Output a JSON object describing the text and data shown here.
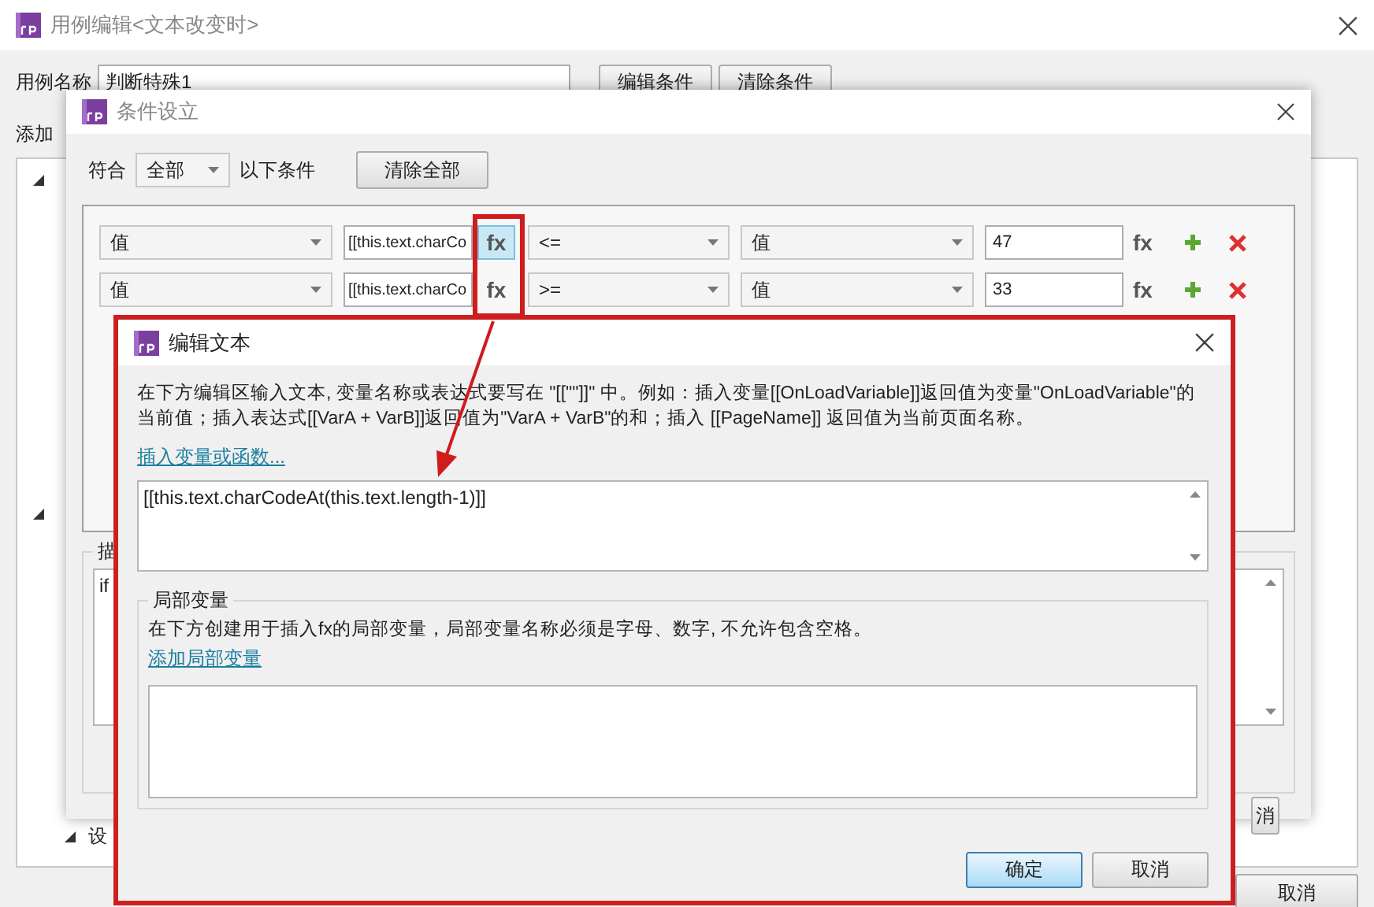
{
  "case_window": {
    "title": "用例编辑<文本改变时>",
    "case_name_label": "用例名称",
    "case_name": "判断特殊1",
    "buttons": [
      "编辑条件",
      "清除条件"
    ],
    "actions_label": "添加",
    "tree_bottom_item": "设",
    "cancel": "取消"
  },
  "condition_dialog": {
    "title": "条件设立",
    "match_label": "符合",
    "match_value": "全部",
    "match_suffix": "以下条件",
    "clear_all": "清除全部",
    "rows": [
      {
        "source": "值",
        "expression": "[[this.text.charCo",
        "fx_button": "fx",
        "fx_highlighted": true,
        "operator": "<=",
        "target": "值",
        "value": "47",
        "value_fx": "fx"
      },
      {
        "source": "值",
        "expression": "[[this.text.charCo",
        "fx_button": "fx",
        "fx_highlighted": false,
        "operator": ">=",
        "target": "值",
        "value": "33",
        "value_fx": "fx"
      }
    ],
    "description_legend": "描",
    "description_text": "if",
    "cancel_partial": "消"
  },
  "edit_text_dialog": {
    "title": "编辑文本",
    "description": "在下方编辑区输入文本, 变量名称或表达式要写在 \"[[\"\"]]\" 中。例如：插入变量[[OnLoadVariable]]返回值为变量\"OnLoadVariable\"的当前值；插入表达式[[VarA + VarB]]返回值为\"VarA + VarB\"的和；插入 [[PageName]] 返回值为当前页面名称。",
    "insert_link": "插入变量或函数...",
    "expression": "[[this.text.charCodeAt(this.text.length-1)]]",
    "local_variables": {
      "legend": "局部变量",
      "description": "在下方创建用于插入fx的局部变量，局部变量名称必须是字母、数字, 不允许包含空格。",
      "add_link": "添加局部变量"
    },
    "buttons": [
      {
        "label": "确定",
        "primary": true
      },
      {
        "label": "取消",
        "primary": false
      }
    ]
  }
}
